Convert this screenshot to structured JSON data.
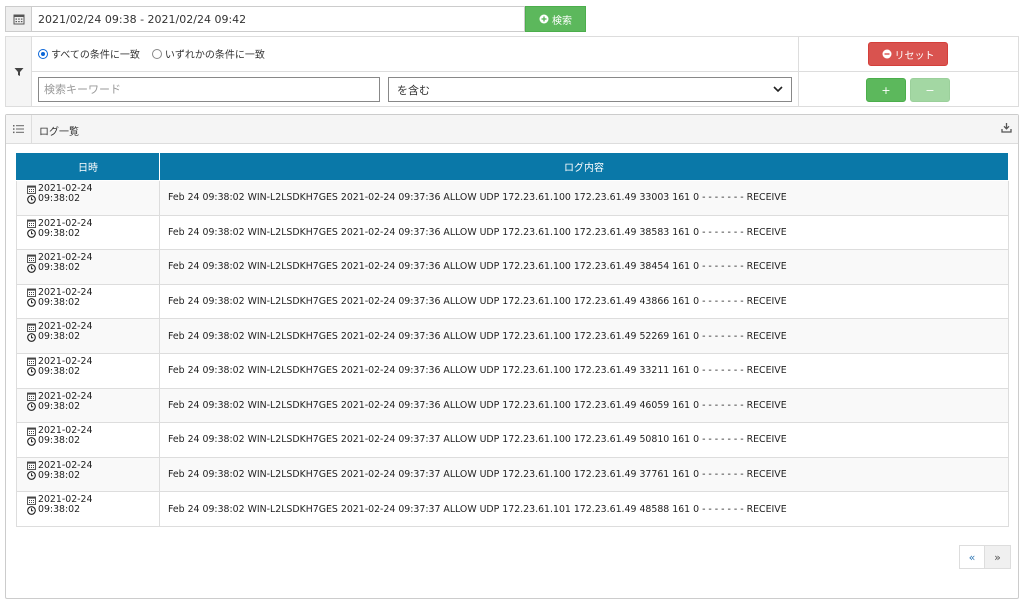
{
  "date_range": {
    "value": "2021/02/24 09:38 - 2021/02/24 09:42",
    "search_label": "検索"
  },
  "filter": {
    "match_all_label": "すべての条件に一致",
    "match_any_label": "いずれかの条件に一致",
    "selected_mode": "all",
    "reset_label": "リセット",
    "keyword_placeholder": "検索キーワード",
    "condition_value": "を含む",
    "add_label": "+",
    "remove_label": "−"
  },
  "log_panel": {
    "title": "ログ一覧",
    "columns": [
      "日時",
      "ログ内容"
    ],
    "rows": [
      {
        "date": "2021-02-24",
        "time": "09:38:02",
        "message": "Feb 24 09:38:02 WIN-L2LSDKH7GES 2021-02-24 09:37:36 ALLOW UDP 172.23.61.100 172.23.61.49 33003 161 0 - - - - - - - RECEIVE"
      },
      {
        "date": "2021-02-24",
        "time": "09:38:02",
        "message": "Feb 24 09:38:02 WIN-L2LSDKH7GES 2021-02-24 09:37:36 ALLOW UDP 172.23.61.100 172.23.61.49 38583 161 0 - - - - - - - RECEIVE"
      },
      {
        "date": "2021-02-24",
        "time": "09:38:02",
        "message": "Feb 24 09:38:02 WIN-L2LSDKH7GES 2021-02-24 09:37:36 ALLOW UDP 172.23.61.100 172.23.61.49 38454 161 0 - - - - - - - RECEIVE"
      },
      {
        "date": "2021-02-24",
        "time": "09:38:02",
        "message": "Feb 24 09:38:02 WIN-L2LSDKH7GES 2021-02-24 09:37:36 ALLOW UDP 172.23.61.100 172.23.61.49 43866 161 0 - - - - - - - RECEIVE"
      },
      {
        "date": "2021-02-24",
        "time": "09:38:02",
        "message": "Feb 24 09:38:02 WIN-L2LSDKH7GES 2021-02-24 09:37:36 ALLOW UDP 172.23.61.100 172.23.61.49 52269 161 0 - - - - - - - RECEIVE"
      },
      {
        "date": "2021-02-24",
        "time": "09:38:02",
        "message": "Feb 24 09:38:02 WIN-L2LSDKH7GES 2021-02-24 09:37:36 ALLOW UDP 172.23.61.100 172.23.61.49 33211 161 0 - - - - - - - RECEIVE"
      },
      {
        "date": "2021-02-24",
        "time": "09:38:02",
        "message": "Feb 24 09:38:02 WIN-L2LSDKH7GES 2021-02-24 09:37:36 ALLOW UDP 172.23.61.100 172.23.61.49 46059 161 0 - - - - - - - RECEIVE"
      },
      {
        "date": "2021-02-24",
        "time": "09:38:02",
        "message": "Feb 24 09:38:02 WIN-L2LSDKH7GES 2021-02-24 09:37:37 ALLOW UDP 172.23.61.100 172.23.61.49 50810 161 0 - - - - - - - RECEIVE"
      },
      {
        "date": "2021-02-24",
        "time": "09:38:02",
        "message": "Feb 24 09:38:02 WIN-L2LSDKH7GES 2021-02-24 09:37:37 ALLOW UDP 172.23.61.100 172.23.61.49 37761 161 0 - - - - - - - RECEIVE"
      },
      {
        "date": "2021-02-24",
        "time": "09:38:02",
        "message": "Feb 24 09:38:02 WIN-L2LSDKH7GES 2021-02-24 09:37:37 ALLOW UDP 172.23.61.101 172.23.61.49 48588 161 0 - - - - - - - RECEIVE"
      }
    ],
    "pager": {
      "prev_label": "«",
      "next_label": "»"
    }
  },
  "icons": {
    "calendar": "calendar-icon",
    "search": "plus-circle-icon",
    "filter": "filter-icon",
    "reset": "minus-circle-icon",
    "list": "list-icon",
    "download": "download-icon",
    "row_date": "calendar-small-icon",
    "row_time": "clock-icon"
  },
  "colors": {
    "primary_green": "#5cb85c",
    "danger_red": "#d9534f",
    "table_header": "#0a78a8"
  }
}
